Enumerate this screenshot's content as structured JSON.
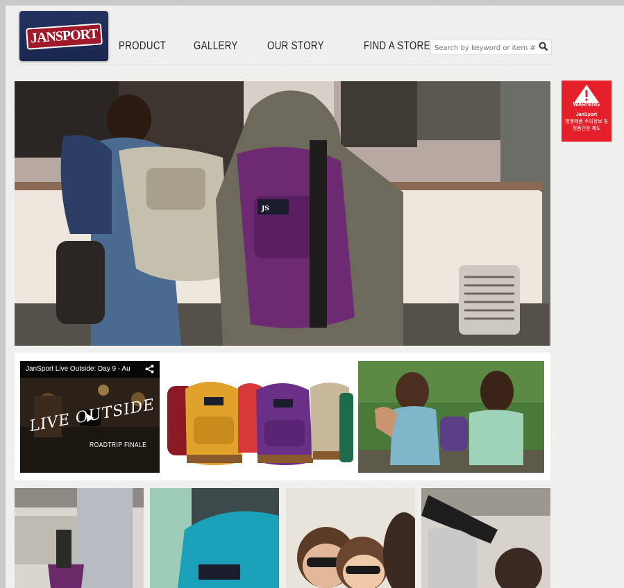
{
  "brand": {
    "logo_text": "JANSPORT"
  },
  "nav": {
    "items": [
      {
        "label": "PRODUCT"
      },
      {
        "label": "GALLERY"
      },
      {
        "label": "OUR STORY"
      },
      {
        "label": "FIND A STORE"
      }
    ]
  },
  "search": {
    "placeholder": "Search by keyword or item #",
    "icon": "search-icon"
  },
  "warning": {
    "label": "WARNING",
    "line1": "JanSport",
    "line2": "병행제품 주의정보 및",
    "line3": "정품인증 제도"
  },
  "video": {
    "title": "JanSport Live Outside: Day 9 - Au",
    "overlay": "LIVE OUTSIDE",
    "sub": "ROADTRIP FINALE",
    "icons": [
      "share-icon",
      "play-icon"
    ]
  },
  "colors": {
    "brand_navy": "#1f2d57",
    "brand_red": "#a0192b",
    "warning_red": "#e4202a",
    "background": "#f1f1ef"
  }
}
